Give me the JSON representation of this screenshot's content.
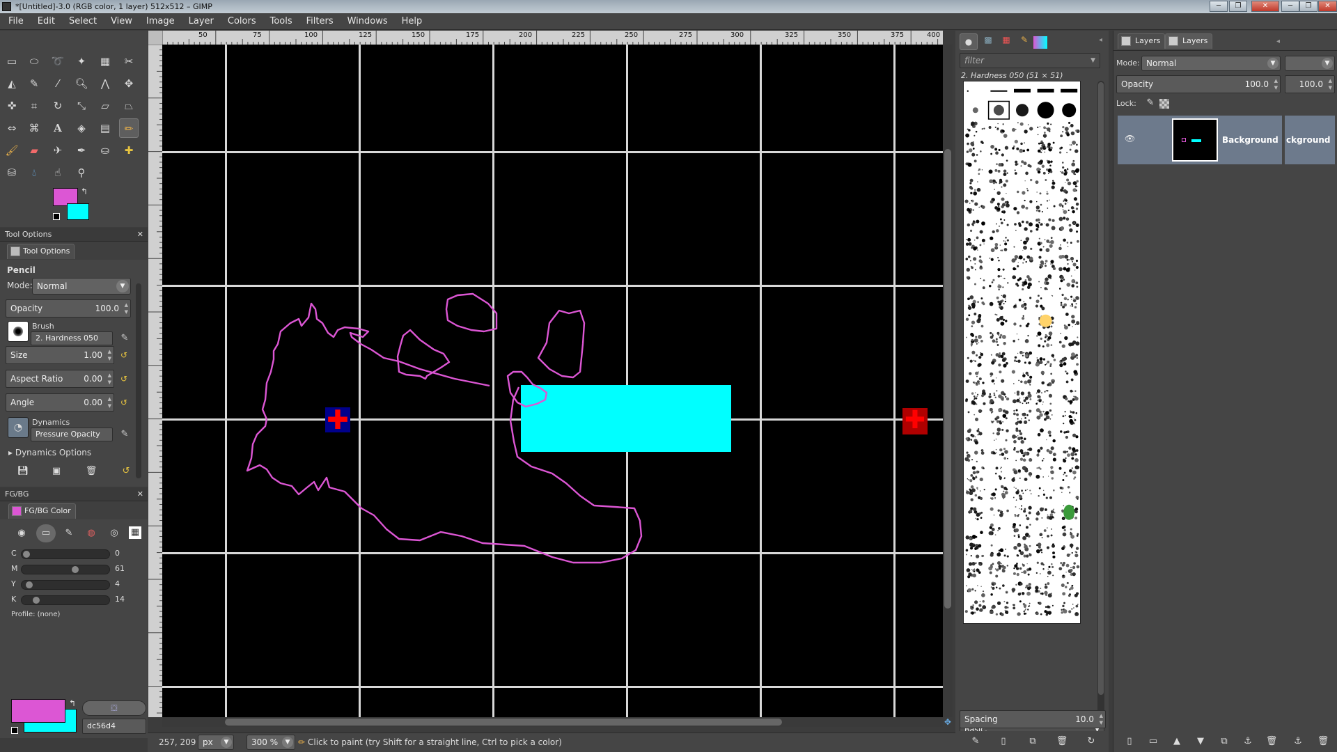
{
  "window": {
    "title": "*[Untitled]-3.0 (RGB color, 1 layer) 512x512 – GIMP",
    "controls": [
      "─",
      "❐",
      "✕"
    ]
  },
  "menubar": [
    "File",
    "Edit",
    "Select",
    "View",
    "Image",
    "Layer",
    "Colors",
    "Tools",
    "Filters",
    "Windows",
    "Help"
  ],
  "colors": {
    "foreground": "#dc56d4",
    "background": "#00ffff",
    "canvas": "#000000",
    "grid": "#d8d8d8",
    "stroke": "#dc56d4",
    "marker_red": "#ff0000",
    "marker_blue": "#00008b"
  },
  "tool_options": {
    "dock_title": "Tool Options",
    "tab_label": "Tool Options",
    "tool_name": "Pencil",
    "mode_label": "Mode:",
    "mode_value": "Normal",
    "opacity_label": "Opacity",
    "opacity_value": "100.0",
    "brush_label": "Brush",
    "brush_value": "2. Hardness 050",
    "size_label": "Size",
    "size_value": "1.00",
    "aspect_label": "Aspect Ratio",
    "aspect_value": "0.00",
    "angle_label": "Angle",
    "angle_value": "0.00",
    "dynamics_label": "Dynamics",
    "dynamics_value": "Pressure Opacity",
    "dynamics_options": "Dynamics Options"
  },
  "fgbg": {
    "dock_title": "FG/BG",
    "tab_label": "FG/BG Color",
    "channels": [
      {
        "label": "C",
        "value": "0"
      },
      {
        "label": "M",
        "value": "61"
      },
      {
        "label": "Y",
        "value": "4"
      },
      {
        "label": "K",
        "value": "14"
      }
    ],
    "profile": "Profile: (none)",
    "hex": "dc56d4"
  },
  "rulers": {
    "top": [
      "50",
      "75",
      "100",
      "125",
      "150",
      "175",
      "200",
      "225",
      "250",
      "275",
      "300",
      "325",
      "350",
      "375",
      "400"
    ]
  },
  "brushes": {
    "filter_placeholder": "filter",
    "selected": "2. Hardness 050 (51 × 51)",
    "preset": "Basic,",
    "spacing_label": "Spacing",
    "spacing_value": "10.0"
  },
  "layers": {
    "tabs": [
      "Layers",
      "Layers"
    ],
    "mode_label": "Mode:",
    "mode_value": "Normal",
    "opacity_label": "Opacity",
    "opacity_value": "100.0",
    "opacity_value2": "100.0",
    "lock_label": "Lock:",
    "layer_name": "Background",
    "layer_name_clipped": "ckground"
  },
  "statusbar": {
    "coords": "257, 209",
    "unit": "px",
    "zoom": "300 %",
    "message": "Click to paint (try Shift for a straight line, Ctrl to pick a color)"
  }
}
